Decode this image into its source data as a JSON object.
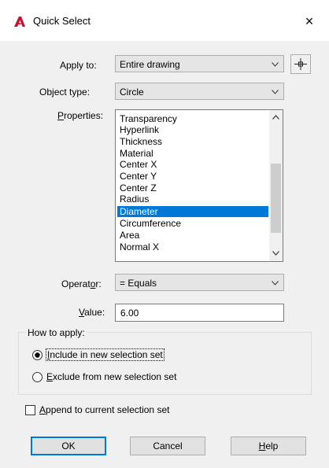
{
  "window": {
    "title": "Quick Select",
    "close_label": "×"
  },
  "apply_to": {
    "label": "Apply to:",
    "value": "Entire drawing"
  },
  "object_type": {
    "label_prefix": "Ob",
    "label_key": "j",
    "label_suffix": "ect type:",
    "value": "Circle"
  },
  "properties": {
    "label_key": "P",
    "label_suffix": "roperties:",
    "items": [
      "Transparency",
      "Hyperlink",
      "Thickness",
      "Material",
      "Center X",
      "Center Y",
      "Center Z",
      "Radius",
      "Diameter",
      "Circumference",
      "Area",
      "Normal X"
    ],
    "selected": "Diameter"
  },
  "operator": {
    "label_prefix": "Operat",
    "label_key": "o",
    "label_suffix": "r:",
    "value": "= Equals"
  },
  "value_field": {
    "label_key": "V",
    "label_suffix": "alue:",
    "value": "6.00"
  },
  "how_to_apply": {
    "title": "How to apply:",
    "include": {
      "label_key": "I",
      "label_suffix": "nclude in new selection set",
      "checked": true
    },
    "exclude": {
      "label_key": "E",
      "label_suffix": "xclude from new selection set",
      "checked": false
    }
  },
  "append": {
    "label_key": "A",
    "label_suffix": "ppend to current selection set",
    "checked": false
  },
  "buttons": {
    "ok": "OK",
    "cancel": "Cancel",
    "help_key": "H",
    "help_suffix": "elp"
  },
  "colors": {
    "accent": "#0078d7",
    "logo": "#c8102e"
  },
  "icons": {
    "logo": "autocad-a-icon",
    "pick": "crosshair-pick-icon"
  }
}
